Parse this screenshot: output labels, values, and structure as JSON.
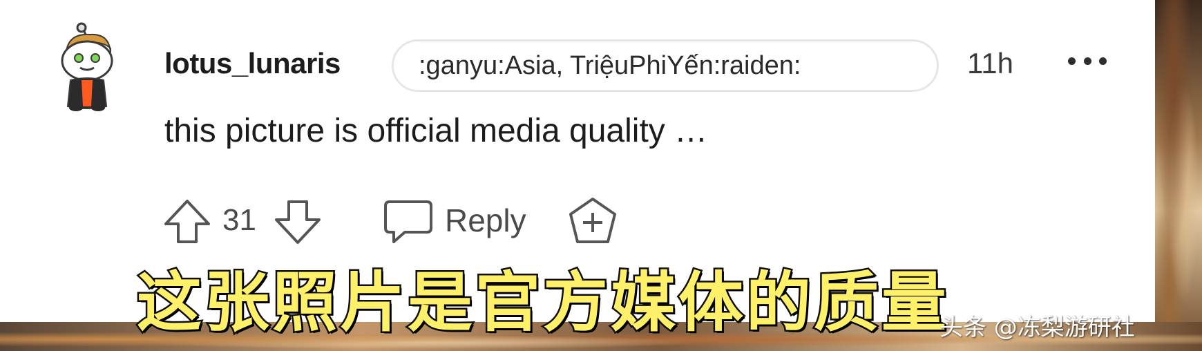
{
  "comment": {
    "username": "lotus_lunaris",
    "flair": ":ganyu:Asia, TriệuPhiYến:raiden:",
    "time": "11h",
    "text": "this picture is official media quality …",
    "score": "31",
    "reply_label": "Reply"
  },
  "icons": {
    "avatar": "snoo-avatar",
    "more": "more-options-icon",
    "upvote": "upvote-arrow-icon",
    "downvote": "downvote-arrow-icon",
    "reply": "comment-bubble-icon",
    "award": "award-plus-icon"
  },
  "overlay": {
    "subtitle": "这张照片是官方媒体的质量",
    "watermark": "头条 @冻梨游研社"
  },
  "colors": {
    "subtitle_fill": "#fff06a",
    "subtitle_stroke": "#111111",
    "text": "#1c1c1c",
    "muted": "#4a4a4a"
  }
}
